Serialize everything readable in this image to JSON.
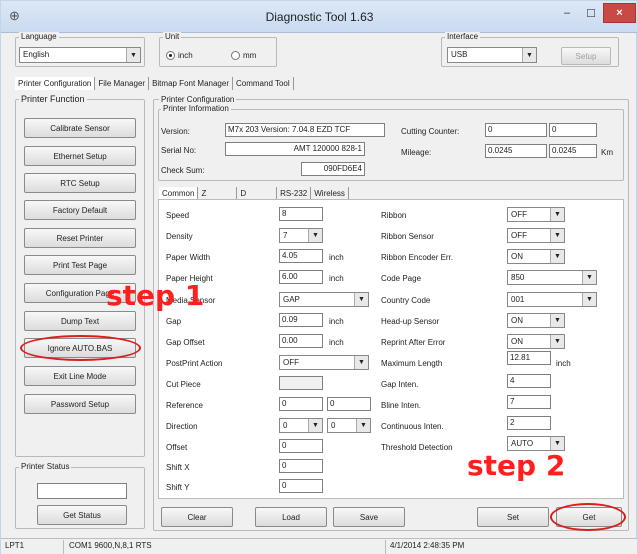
{
  "window": {
    "title": "Diagnostic Tool 1.63",
    "minimize_glyph": "–",
    "maximize_glyph": "☐",
    "close_glyph": "×"
  },
  "top": {
    "language_label": "Language",
    "language_value": "English",
    "unit_label": "Unit",
    "unit_inch": "inch",
    "unit_mm": "mm",
    "interface_label": "Interface",
    "interface_value": "USB",
    "setup_label": "Setup"
  },
  "tabs": [
    "Printer Configuration",
    "File Manager",
    "Bitmap Font Manager",
    "Command Tool"
  ],
  "printer_function": {
    "label": "Printer Function",
    "buttons": [
      "Calibrate Sensor",
      "Ethernet Setup",
      "RTC Setup",
      "Factory Default",
      "Reset Printer",
      "Print Test Page",
      "Configuration Page",
      "Dump Text",
      "Ignore AUTO.BAS",
      "Exit Line Mode",
      "Password Setup"
    ]
  },
  "printer_status": {
    "label": "Printer Status",
    "get_status": "Get Status",
    "value": ""
  },
  "config": {
    "label": "Printer Configuration",
    "info_label": "Printer Information",
    "version_label": "Version:",
    "version_value": "M7x 203 Version: 7.04.8 EZD TCF",
    "serial_label": "Serial No:",
    "serial_value": "AMT 120000 828-1",
    "checksum_label": "Check Sum:",
    "checksum_value": "090FD6E4",
    "cut_counter_label": "Cutting Counter:",
    "cut_counter_1": "0",
    "cut_counter_2": "0",
    "mileage_label": "Mileage:",
    "mileage_1": "0.0245",
    "mileage_2": "0.0245",
    "mileage_unit": "Km"
  },
  "sub_tabs": [
    "Common",
    "Z",
    "D",
    "RS-232",
    "Wireless"
  ],
  "left_fields": {
    "speed": {
      "label": "Speed",
      "value": "8"
    },
    "density": {
      "label": "Density",
      "value": "7"
    },
    "paper_width": {
      "label": "Paper Width",
      "value": "4.05",
      "unit": "inch"
    },
    "paper_height": {
      "label": "Paper Height",
      "value": "6.00",
      "unit": "inch"
    },
    "media_sensor": {
      "label": "Media Sensor",
      "value": "GAP"
    },
    "gap": {
      "label": "Gap",
      "value": "0.09",
      "unit": "inch"
    },
    "gap_offset": {
      "label": "Gap Offset",
      "value": "0.00",
      "unit": "inch"
    },
    "post_print": {
      "label": "PostPrint Action",
      "value": "OFF"
    },
    "cut_piece": {
      "label": "Cut Piece",
      "value": ""
    },
    "reference": {
      "label": "Reference",
      "value_1": "0",
      "value_2": "0"
    },
    "direction": {
      "label": "Direction",
      "value_1": "0",
      "value_2": "0"
    },
    "offset": {
      "label": "Offset",
      "value": "0"
    },
    "shift_x": {
      "label": "Shift X",
      "value": "0"
    },
    "shift_y": {
      "label": "Shift Y",
      "value": "0"
    }
  },
  "right_fields": {
    "ribbon": {
      "label": "Ribbon",
      "value": "OFF"
    },
    "ribbon_sensor": {
      "label": "Ribbon Sensor",
      "value": "OFF"
    },
    "ribbon_encoder": {
      "label": "Ribbon Encoder Err.",
      "value": "ON"
    },
    "code_page": {
      "label": "Code Page",
      "value": "850"
    },
    "country_code": {
      "label": "Country Code",
      "value": "001"
    },
    "headup_sensor": {
      "label": "Head-up Sensor",
      "value": "ON"
    },
    "reprint": {
      "label": "Reprint After Error",
      "value": "ON"
    },
    "max_length": {
      "label": "Maximum Length",
      "value": "12.81",
      "unit": "inch"
    },
    "gap_inten": {
      "label": "Gap Inten.",
      "value": "4"
    },
    "bline_inten": {
      "label": "Bline Inten.",
      "value": "7"
    },
    "continuous_inten": {
      "label": "Continuous Inten.",
      "value": "2"
    },
    "threshold": {
      "label": "Threshold Detection",
      "value": "AUTO"
    }
  },
  "bottom_buttons": {
    "clear": "Clear",
    "load": "Load",
    "save": "Save",
    "set": "Set",
    "get": "Get"
  },
  "annotations": {
    "step1": "step 1",
    "step2": "step 2",
    "highlight_color": "#d91e1e"
  },
  "statusbar": {
    "port": "LPT1",
    "com": "COM1 9600,N,8,1 RTS",
    "datetime": "4/1/2014 2:48:35 PM"
  }
}
